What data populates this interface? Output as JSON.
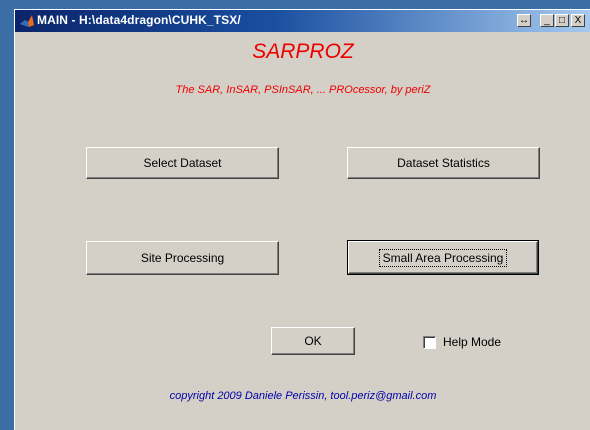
{
  "window": {
    "title": "MAIN - H:\\data4dragon\\CUHK_TSX/",
    "resize_glyph": "↔",
    "minimize_glyph": "_",
    "maximize_glyph": "□",
    "close_glyph": "X"
  },
  "header": {
    "app_name": "SARPROZ",
    "tagline": "The SAR, InSAR, PSInSAR, ... PROcessor, by periZ"
  },
  "buttons": {
    "select_dataset": "Select Dataset",
    "dataset_statistics": "Dataset Statistics",
    "site_processing": "Site Processing",
    "small_area_processing": "Small Area Processing",
    "ok": "OK"
  },
  "help_mode": {
    "label": "Help Mode",
    "checked": false
  },
  "footer": {
    "copyright": "copyright 2009 Daniele Perissin, tool.periz@gmail.com"
  },
  "colors": {
    "accent_red": "#ee0000",
    "footer_blue": "#0000aa",
    "panel": "#d4d0c8",
    "desktop": "#3a6ea5"
  },
  "icons": {
    "app": "matlab-icon"
  }
}
